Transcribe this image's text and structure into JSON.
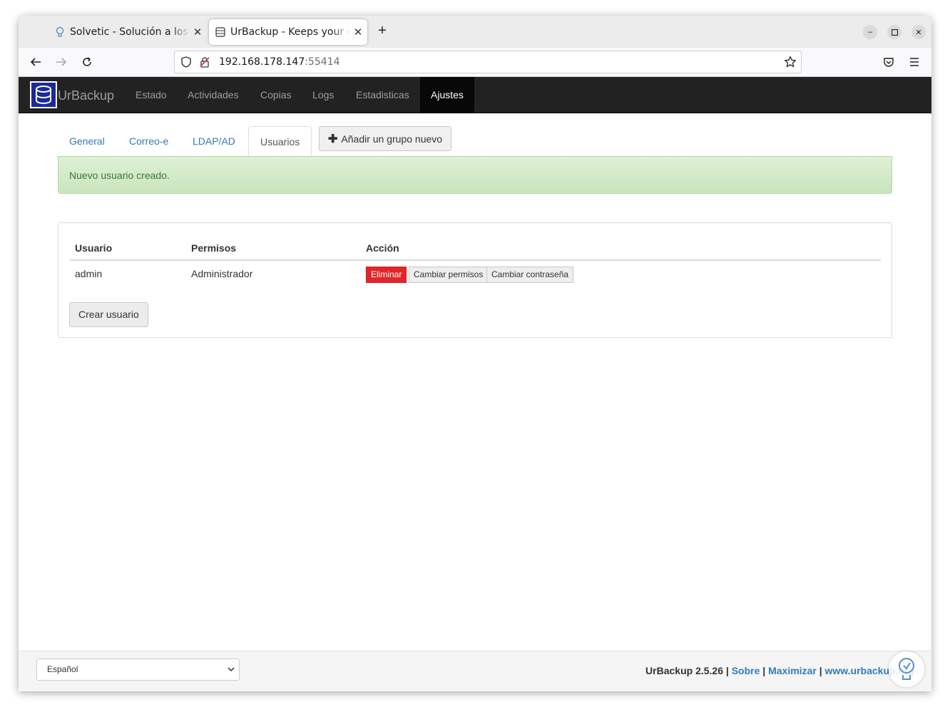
{
  "browser": {
    "tabs": [
      {
        "title": "Solvetic - Solución a los pr",
        "active": false,
        "icon": "bulb-icon"
      },
      {
        "title": "UrBackup - Keeps your da",
        "active": true,
        "icon": "database-icon"
      }
    ],
    "url": {
      "host": "192.168.178.147",
      "port": ":55414"
    }
  },
  "app": {
    "brand": "UrBackup",
    "nav": [
      "Estado",
      "Actividades",
      "Copias",
      "Logs",
      "Estadisticas",
      "Ajustes"
    ],
    "active_nav": "Ajustes"
  },
  "settings_tabs": [
    "General",
    "Correo-e",
    "LDAP/AD",
    "Usuarios"
  ],
  "active_settings_tab": "Usuarios",
  "add_group_label": "Añadir un grupo nuevo",
  "alert": {
    "text": "Nuevo usuario creado.",
    "type": "success"
  },
  "users_table": {
    "headers": [
      "Usuario",
      "Permisos",
      "Acción"
    ],
    "rows": [
      {
        "user": "admin",
        "permissions": "Administrador",
        "actions": [
          "Eliminar",
          "Cambiar permisos",
          "Cambiar contraseña"
        ]
      }
    ]
  },
  "create_user_label": "Crear usuario",
  "footer": {
    "language": "Español",
    "version_text": "UrBackup 2.5.26",
    "sep": "|",
    "links": [
      "Sobre",
      "Maximizar",
      "www.urbackup.org"
    ]
  },
  "colors": {
    "navbar": "#222222",
    "link": "#337ab7",
    "danger": "#e2252a",
    "success_bg": "#dff0d8"
  }
}
